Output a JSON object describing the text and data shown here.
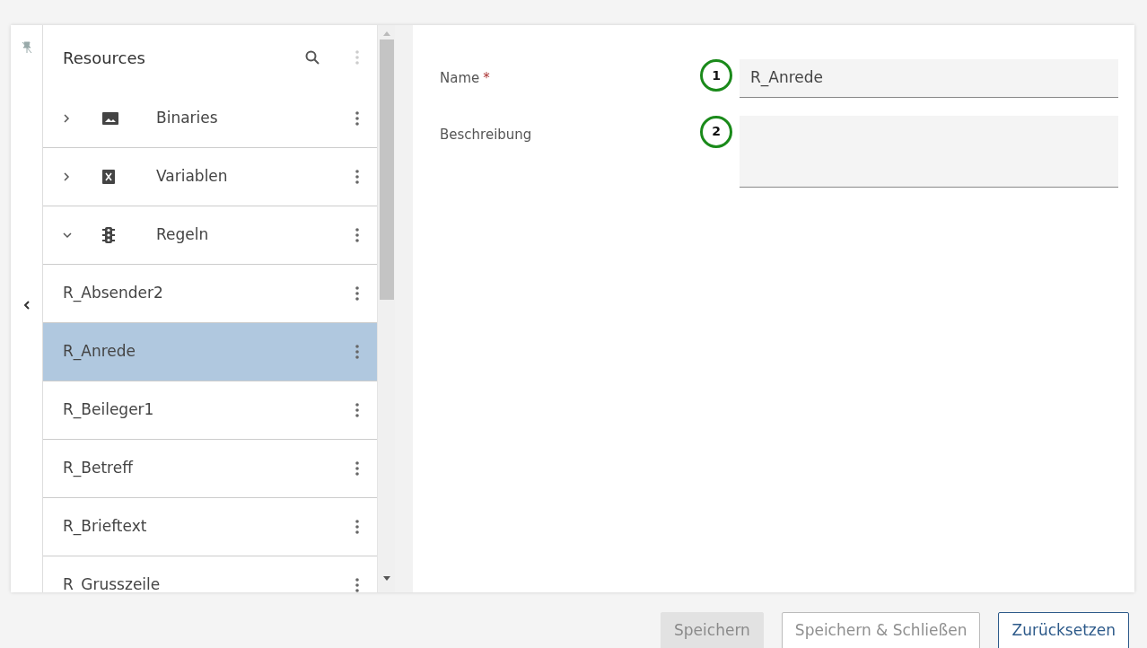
{
  "sidebar": {
    "title": "Resources",
    "items": [
      {
        "label": "Binaries",
        "kind": "image",
        "expanded": false
      },
      {
        "label": "Variablen",
        "kind": "variable",
        "expanded": false
      },
      {
        "label": "Regeln",
        "kind": "rule",
        "expanded": true,
        "children": [
          {
            "label": "R_Absender2",
            "selected": false
          },
          {
            "label": "R_Anrede",
            "selected": true
          },
          {
            "label": "R_Beileger1",
            "selected": false
          },
          {
            "label": "R_Betreff",
            "selected": false
          },
          {
            "label": "R_Brieftext",
            "selected": false
          },
          {
            "label": "R_Grusszeile",
            "selected": false
          }
        ]
      }
    ]
  },
  "form": {
    "fields": [
      {
        "label": "Name",
        "required_mark": "*",
        "marker": "1",
        "value": "R_Anrede",
        "kind": "input"
      },
      {
        "label": "Beschreibung",
        "marker": "2",
        "kind": "textarea"
      }
    ]
  },
  "buttons": [
    {
      "label": "Speichern",
      "disabled": true,
      "kind": "filled"
    },
    {
      "label": "Speichern & Schließen",
      "disabled": true,
      "kind": "outline"
    },
    {
      "label": "Zurücksetzen",
      "disabled": false,
      "kind": "outline"
    }
  ]
}
